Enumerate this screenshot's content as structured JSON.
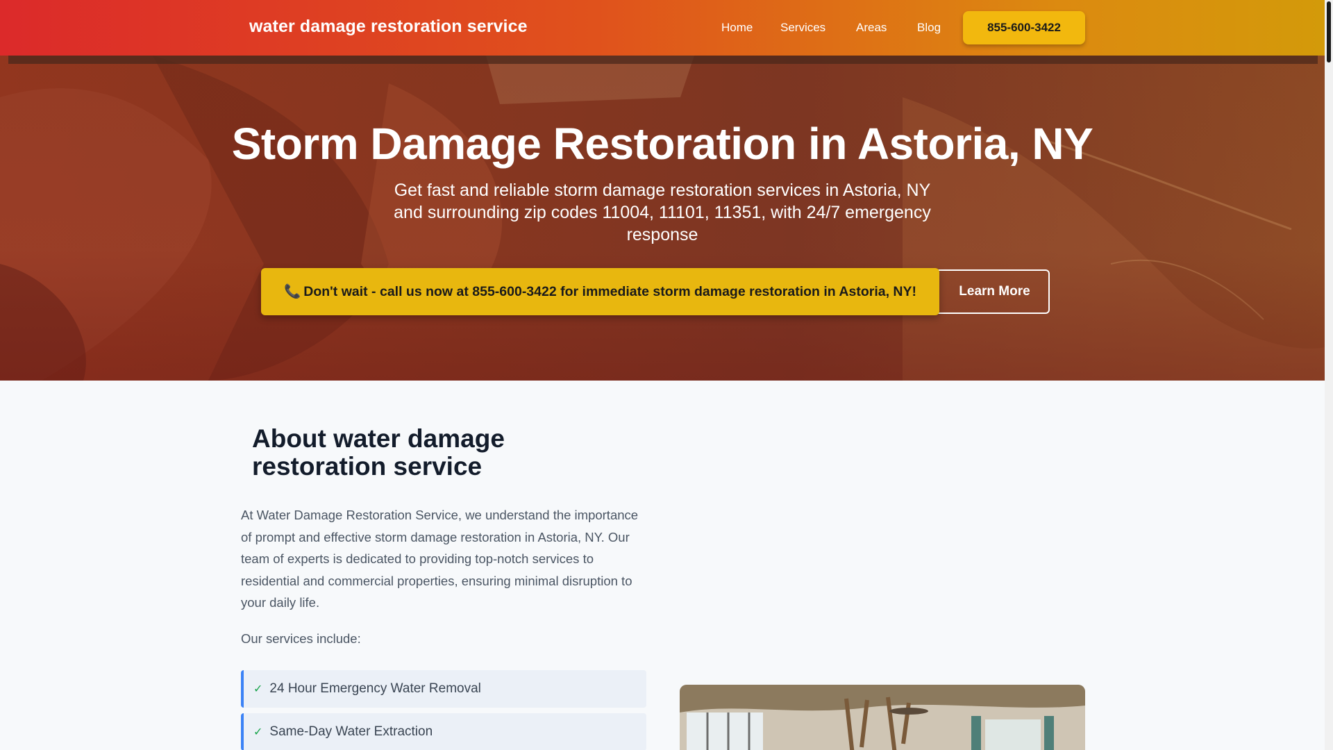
{
  "header": {
    "brand": "water damage restoration service",
    "nav": [
      "Home",
      "Services",
      "Areas",
      "Blog"
    ],
    "phone": "855-600-3422"
  },
  "hero": {
    "title": "Storm Damage Restoration in Astoria, NY",
    "subtitle": "Get fast and reliable storm damage restoration services in Astoria, NY and surrounding zip codes 11004, 11101, 11351, with 24/7 emergency response",
    "cta_call_icon": "📞",
    "cta_call": "Don't wait - call us now at 855-600-3422 for immediate storm damage restoration in Astoria, NY!",
    "cta_learn": "Learn More"
  },
  "about": {
    "title": "About water damage restoration service",
    "paragraph": "At Water Damage Restoration Service, we understand the importance of prompt and effective storm damage restoration in Astoria, NY. Our team of experts is dedicated to providing top-notch services to residential and commercial properties, ensuring minimal disruption to your daily life.",
    "services_lead": "Our services include:",
    "check_glyph": "✓",
    "services": [
      "24 Hour Emergency Water Removal",
      "Same-Day Water Extraction"
    ]
  },
  "colors": {
    "header_start": "#dc2a2a",
    "header_end": "#d39a0a",
    "accent_yellow": "#e8b70f",
    "list_border": "#3b82f6",
    "check": "#16a34a"
  },
  "icons": {
    "call_cta": "phone-icon",
    "list_item": "check-icon"
  }
}
